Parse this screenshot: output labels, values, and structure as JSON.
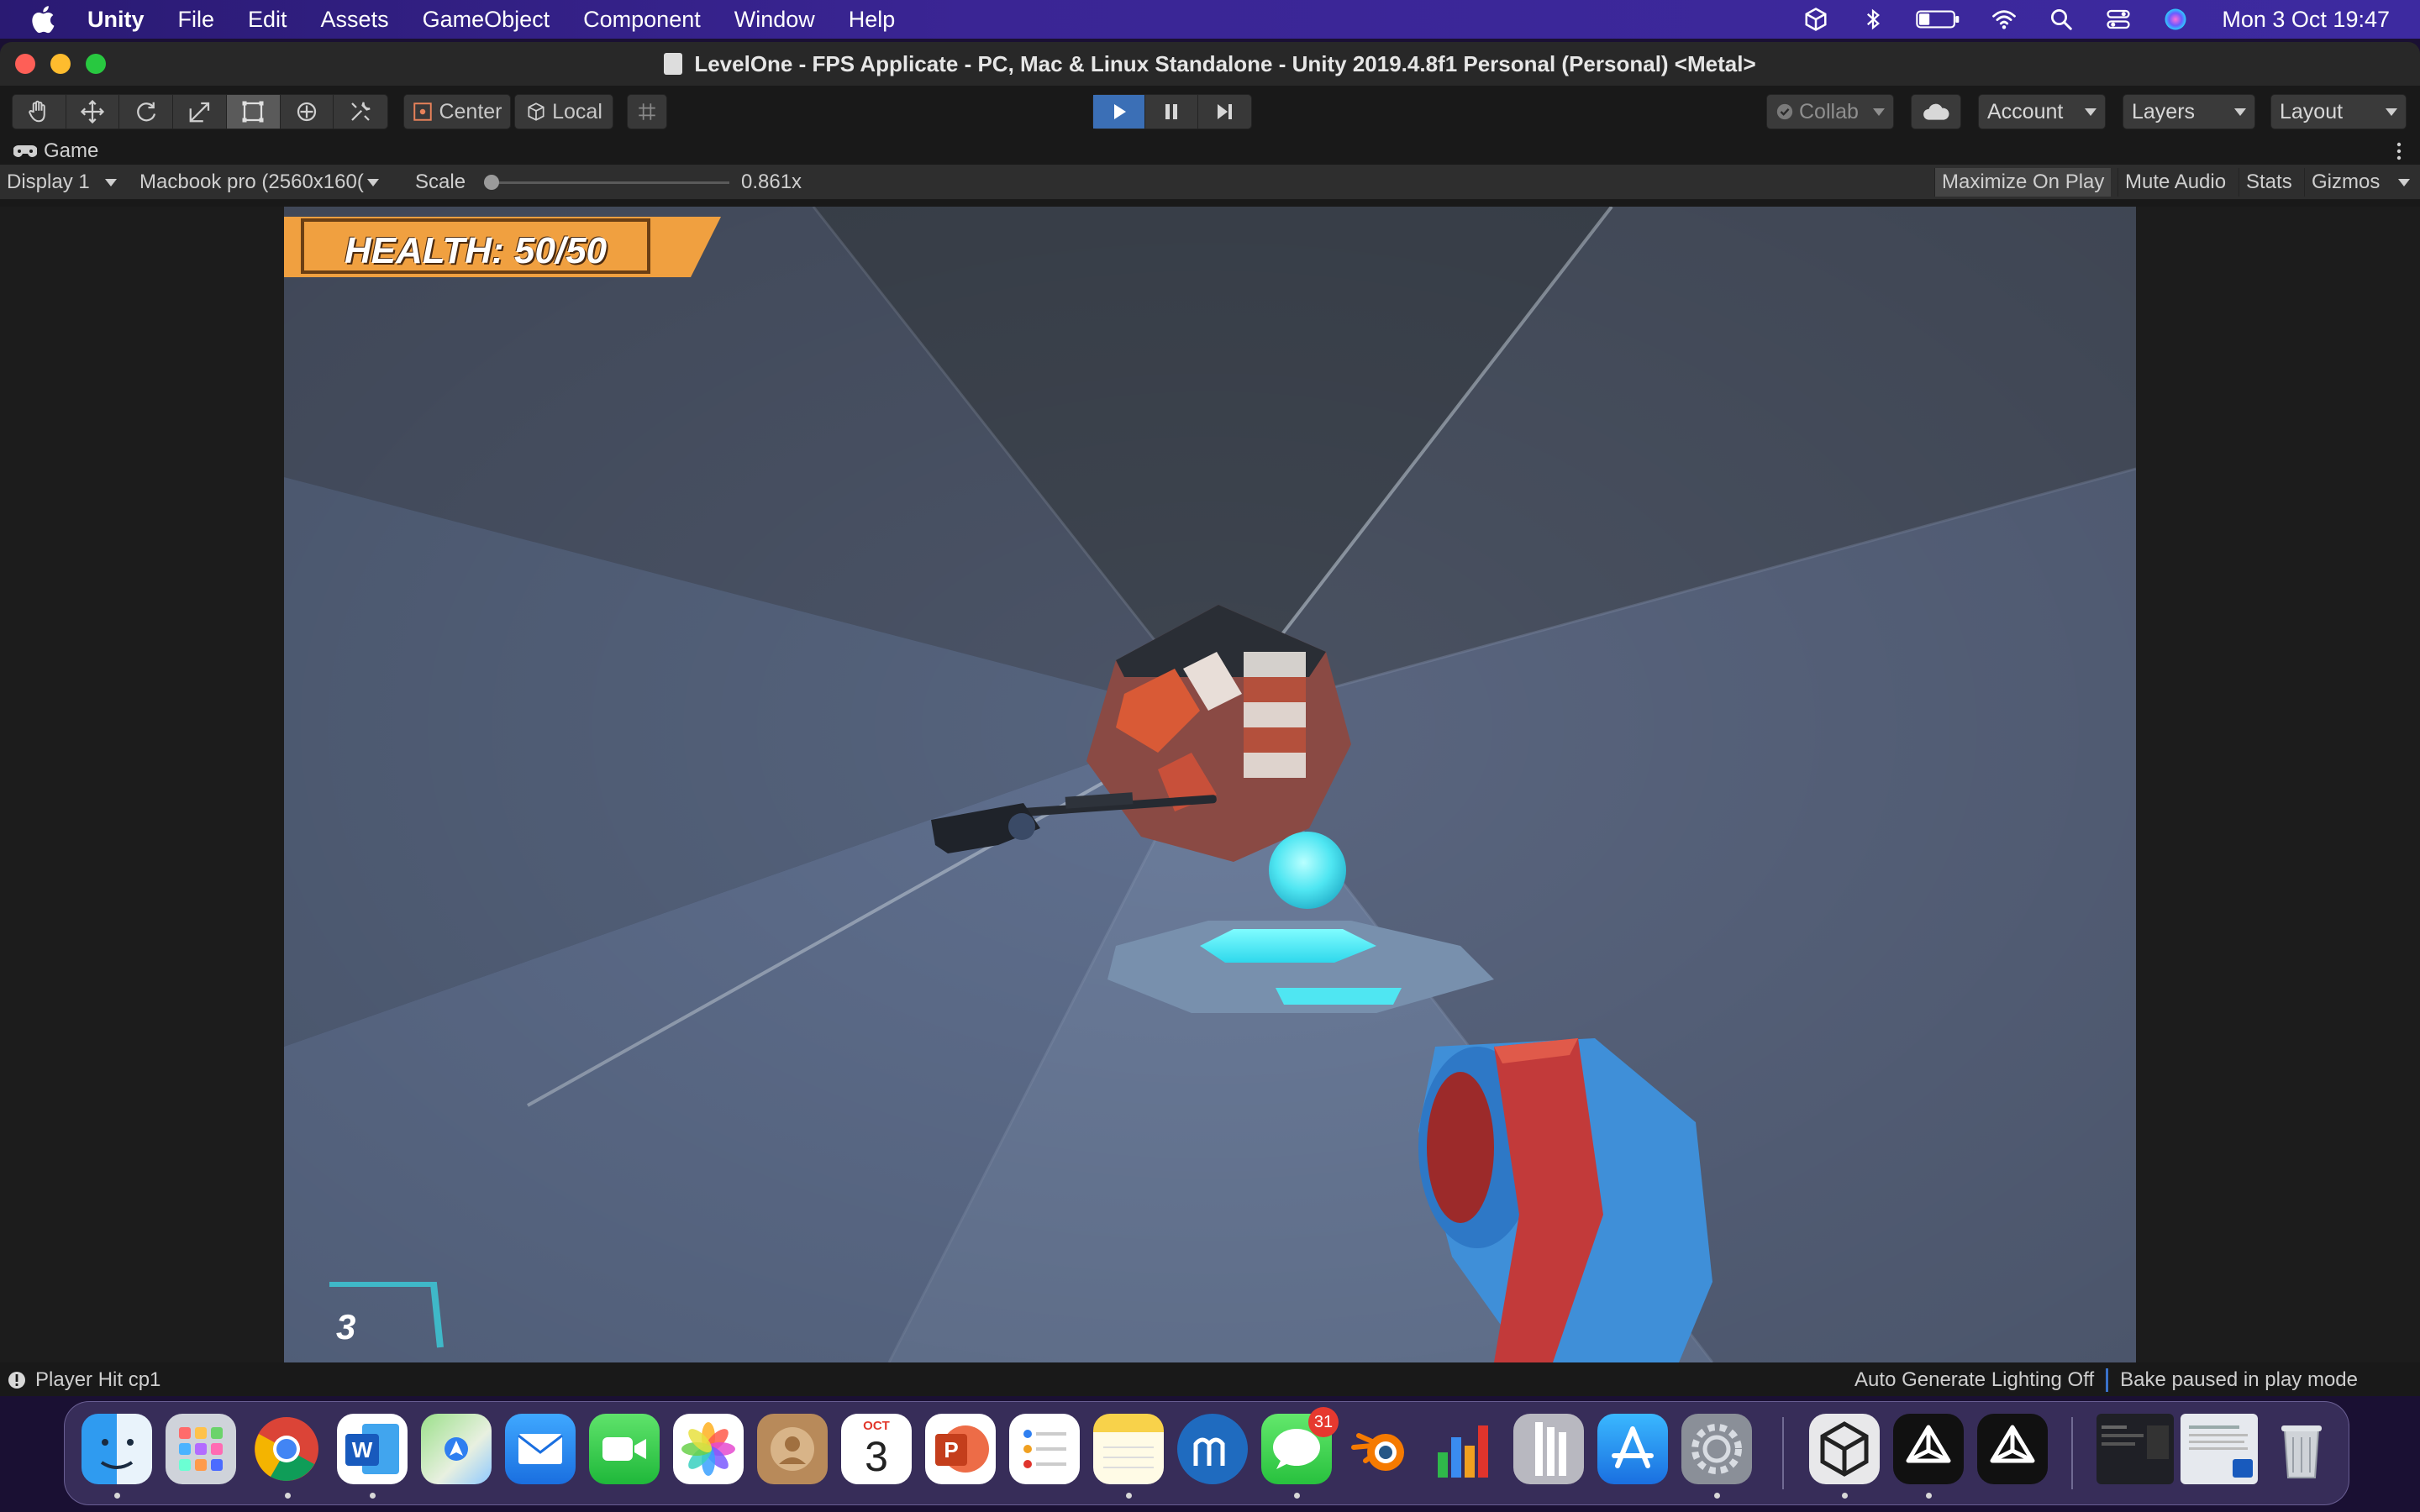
{
  "menubar": {
    "app_name": "Unity",
    "items": [
      "File",
      "Edit",
      "Assets",
      "GameObject",
      "Component",
      "Window",
      "Help"
    ],
    "clock": "Mon 3 Oct  19:47"
  },
  "window": {
    "title": "LevelOne - FPS Applicate - PC, Mac & Linux Standalone - Unity 2019.4.8f1 Personal (Personal) <Metal>"
  },
  "toolbar": {
    "pivot_label": "Center",
    "space_label": "Local",
    "collab_label": "Collab",
    "account_label": "Account",
    "layers_label": "Layers",
    "layout_label": "Layout"
  },
  "game_tab": {
    "label": "Game"
  },
  "game_bar": {
    "display": "Display 1",
    "resolution": "Macbook pro (2560x160(",
    "scale_label": "Scale",
    "scale_value": "0.861x",
    "scale_fraction": 0.0,
    "maximize_label": "Maximize On Play",
    "mute_label": "Mute Audio",
    "stats_label": "Stats",
    "gizmos_label": "Gizmos"
  },
  "hud": {
    "health": "HEALTH: 50/50",
    "ammo": "3"
  },
  "status": {
    "message": "Player Hit cp1",
    "lighting": "Auto Generate Lighting Off",
    "bake": "Bake paused in play mode"
  },
  "dock": {
    "apps": [
      "Finder",
      "Launchpad",
      "Chrome",
      "Word",
      "Maps",
      "Mail",
      "FaceTime",
      "Photos",
      "Contacts",
      "Calendar",
      "PowerPoint",
      "Reminders",
      "Notes",
      "MuseScore",
      "Messages",
      "Blender",
      "Numbers",
      "Tower",
      "App Store",
      "System Preferences",
      "Unity Hub",
      "Unity",
      "Unity"
    ],
    "calendar_month": "OCT",
    "calendar_day": "3",
    "messages_badge": "31"
  },
  "colors": {
    "health_banner": "#f0a040",
    "ammo_accent": "#3fb8c8",
    "play_active": "#3b6fb6"
  }
}
